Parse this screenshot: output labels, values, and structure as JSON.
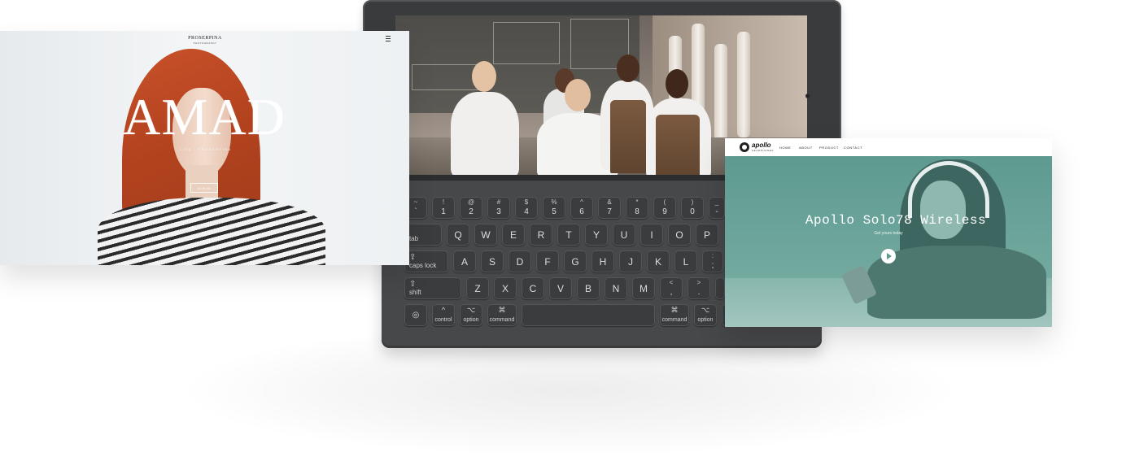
{
  "left_card": {
    "brand": "PROSERPINA",
    "brand_sub": "PHOTOGRAPHY",
    "hero_title": "AMAD",
    "hero_subtitle": "LIFE . PROSERPINA",
    "album_button": "ALBUM",
    "menu_icon": "hamburger-icon"
  },
  "right_card": {
    "logo": "apollo",
    "logo_sub": "HEADPHONES",
    "nav": [
      "HOME",
      "ABOUT",
      "PRODUCT",
      "CONTACT"
    ],
    "hero_title": "Apollo Solo78 Wireless",
    "hero_subtitle": "Get yours today",
    "play_icon": "play-icon",
    "accent_color": "#5e9a90"
  },
  "keyboard": {
    "number_row": [
      {
        "top": "~",
        "bot": "`"
      },
      {
        "top": "!",
        "bot": "1"
      },
      {
        "top": "@",
        "bot": "2"
      },
      {
        "top": "#",
        "bot": "3"
      },
      {
        "top": "$",
        "bot": "4"
      },
      {
        "top": "%",
        "bot": "5"
      },
      {
        "top": "^",
        "bot": "6"
      },
      {
        "top": "&",
        "bot": "7"
      },
      {
        "top": "*",
        "bot": "8"
      },
      {
        "top": "(",
        "bot": "9"
      },
      {
        "top": ")",
        "bot": "0"
      },
      {
        "top": "_",
        "bot": "-"
      }
    ],
    "tab": "tab",
    "row_q": [
      "Q",
      "W",
      "E",
      "R",
      "T",
      "Y",
      "U",
      "I",
      "O",
      "P"
    ],
    "caps_lock": "caps lock",
    "row_a": [
      "A",
      "S",
      "D",
      "F",
      "G",
      "H",
      "J",
      "K",
      "L"
    ],
    "semicolon": {
      "top": ":",
      "bot": ";"
    },
    "shift": "shift",
    "row_z": [
      "Z",
      "X",
      "C",
      "V",
      "B",
      "N",
      "M"
    ],
    "comma": {
      "top": "<",
      "bot": ","
    },
    "period": {
      "top": ">",
      "bot": "."
    },
    "control": "control",
    "option": "option",
    "command": "command",
    "control_symbol": "^",
    "option_symbol": "⌥",
    "command_symbol": "⌘"
  }
}
